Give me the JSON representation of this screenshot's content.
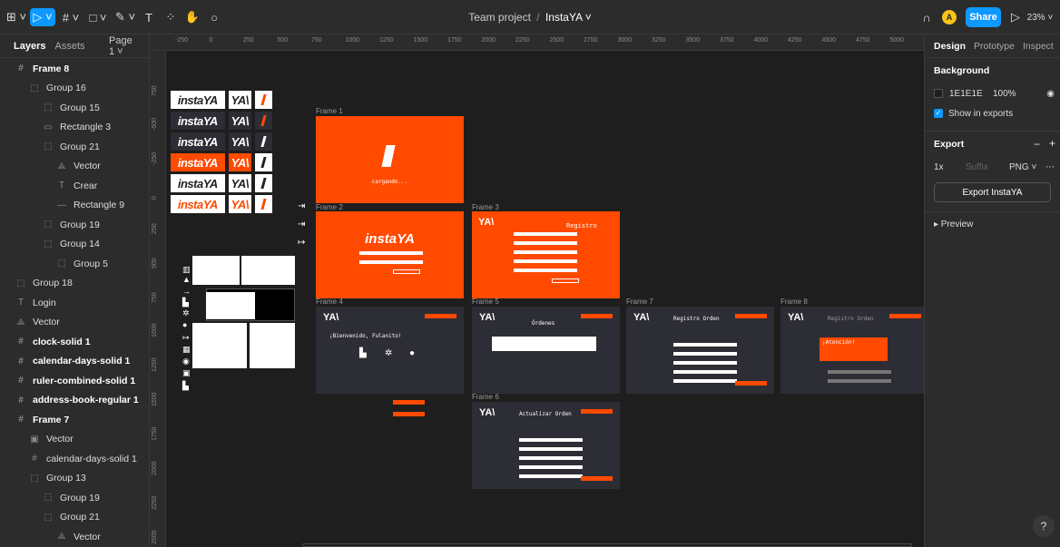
{
  "toolbar": {
    "tools": [
      "⊞ ˅",
      "▷ ˅",
      "# ˅",
      "□ ˅",
      "✎ ˅",
      "T",
      "⁘",
      "✋",
      "○"
    ],
    "zoom": "23% ˅",
    "share_label": "Share",
    "avatar_initial": "A",
    "play_icon": "▷",
    "headphone_icon": "∩"
  },
  "document": {
    "team": "Team project",
    "separator": "/",
    "name": "InstaYA ˅"
  },
  "left_panel": {
    "tab_layers": "Layers",
    "tab_assets": "Assets",
    "page": "Page 1 ˅",
    "layers": [
      {
        "icon": "#",
        "name": "Frame 8",
        "indent": 0,
        "bold": true
      },
      {
        "icon": "⬚",
        "name": "Group 16",
        "indent": 1,
        "bold": false
      },
      {
        "icon": "⬚",
        "name": "Group 15",
        "indent": 2,
        "bold": false
      },
      {
        "icon": "▭",
        "name": "Rectangle 3",
        "indent": 2,
        "bold": false
      },
      {
        "icon": "⬚",
        "name": "Group 21",
        "indent": 2,
        "bold": false
      },
      {
        "icon": "⟁",
        "name": "Vector",
        "indent": 3,
        "bold": false
      },
      {
        "icon": "T",
        "name": "Crear",
        "indent": 3,
        "bold": false
      },
      {
        "icon": "—",
        "name": "Rectangle 9",
        "indent": 3,
        "bold": false
      },
      {
        "icon": "⬚",
        "name": "Group 19",
        "indent": 2,
        "bold": false
      },
      {
        "icon": "⬚",
        "name": "Group 14",
        "indent": 2,
        "bold": false
      },
      {
        "icon": "⬚",
        "name": "Group 5",
        "indent": 3,
        "bold": false
      },
      {
        "icon": "⬚",
        "name": "Group 18",
        "indent": 0,
        "bold": false
      },
      {
        "icon": "T",
        "name": "Login",
        "indent": 0,
        "bold": false
      },
      {
        "icon": "⟁",
        "name": "Vector",
        "indent": 0,
        "bold": false
      },
      {
        "icon": "#",
        "name": "clock-solid 1",
        "indent": 0,
        "bold": true
      },
      {
        "icon": "#",
        "name": "calendar-days-solid 1",
        "indent": 0,
        "bold": true
      },
      {
        "icon": "#",
        "name": "ruler-combined-solid 1",
        "indent": 0,
        "bold": true
      },
      {
        "icon": "#",
        "name": "address-book-regular 1",
        "indent": 0,
        "bold": true
      },
      {
        "icon": "#",
        "name": "Frame 7",
        "indent": 0,
        "bold": true
      },
      {
        "icon": "▣",
        "name": "Vector",
        "indent": 1,
        "bold": false
      },
      {
        "icon": "#",
        "name": "calendar-days-solid 1",
        "indent": 1,
        "bold": false
      },
      {
        "icon": "⬚",
        "name": "Group 13",
        "indent": 1,
        "bold": false
      },
      {
        "icon": "⬚",
        "name": "Group 19",
        "indent": 2,
        "bold": false
      },
      {
        "icon": "⬚",
        "name": "Group 21",
        "indent": 2,
        "bold": false
      },
      {
        "icon": "⟁",
        "name": "Vector",
        "indent": 3,
        "bold": false
      }
    ]
  },
  "rulers": {
    "top": [
      "-250",
      "0",
      "250",
      "500",
      "750",
      "1000",
      "1250",
      "1500",
      "1750",
      "2000",
      "2250",
      "2500",
      "2750",
      "3000",
      "3250",
      "3500",
      "3750",
      "4000",
      "4250",
      "4500",
      "4750",
      "5000"
    ],
    "left": [
      "750",
      "-500",
      "-250",
      "0",
      "250",
      "500",
      "750",
      "1000",
      "1250",
      "1500",
      "1750",
      "2000",
      "2250",
      "2500"
    ]
  },
  "canvas": {
    "frames": {
      "f1": "Frame 1",
      "f2": "Frame 2",
      "f3": "Frame 3",
      "f4": "Frame 4",
      "f5": "Frame 5",
      "f6": "Frame 6",
      "f7": "Frame 7",
      "f8": "Frame 8"
    },
    "logo_text": "instaYA",
    "ya_text": "YA\\",
    "loading_text": "cargando...",
    "registro_title": "Registro",
    "welcome_text": "¡Bienvenido, Fulanito!",
    "ordenes_title": "Órdenes",
    "registro_orden_title": "Registro Orden",
    "actualizar_orden_title": "Actualizar Orden",
    "atencion_title": "¡Atención!"
  },
  "right_panel": {
    "tab_design": "Design",
    "tab_prototype": "Prototype",
    "tab_inspect": "Inspect",
    "background_heading": "Background",
    "bg_hex": "1E1E1E",
    "bg_opacity": "100%",
    "show_in_exports": "Show in exports",
    "export_heading": "Export",
    "export_scale": "1x",
    "export_suffix": "Suffix",
    "export_format": "PNG ˅",
    "export_button": "Export InstaYA",
    "preview_label": "▸ Preview"
  },
  "help_label": "?"
}
